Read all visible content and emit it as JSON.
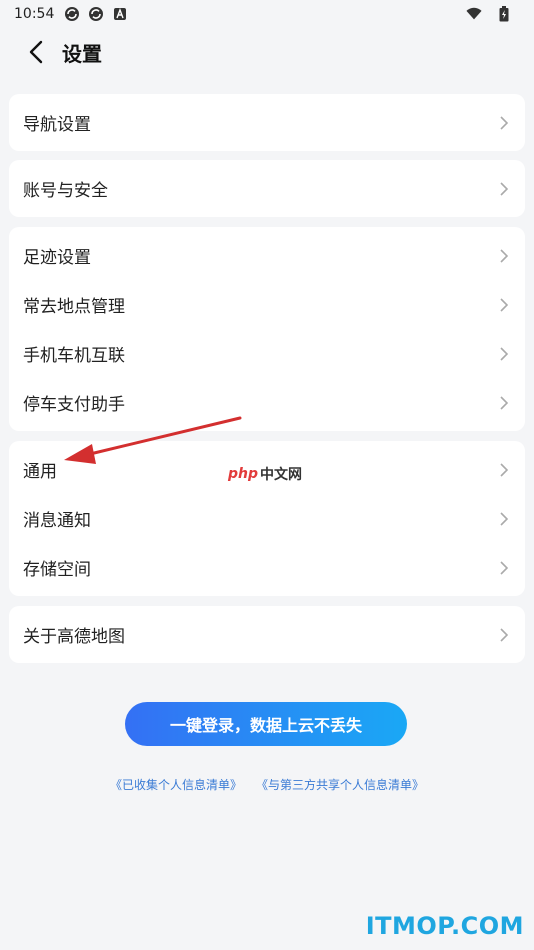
{
  "status_bar": {
    "time": "10:54"
  },
  "header": {
    "title": "设置"
  },
  "groups": [
    {
      "items": [
        {
          "label": "导航设置"
        }
      ]
    },
    {
      "items": [
        {
          "label": "账号与安全"
        }
      ]
    },
    {
      "items": [
        {
          "label": "足迹设置"
        },
        {
          "label": "常去地点管理"
        },
        {
          "label": "手机车机互联"
        },
        {
          "label": "停车支付助手"
        }
      ]
    },
    {
      "items": [
        {
          "label": "通用"
        },
        {
          "label": "消息通知"
        },
        {
          "label": "存储空间"
        }
      ]
    },
    {
      "items": [
        {
          "label": "关于高德地图"
        }
      ]
    }
  ],
  "login_button": {
    "label": "一键登录，数据上云不丢失"
  },
  "links": {
    "collected": "《已收集个人信息清单》",
    "shared": "《与第三方共享个人信息清单》"
  },
  "watermarks": {
    "php_logo": "php",
    "php_text": "中文网",
    "itmop": "ITMOP.COM"
  },
  "colors": {
    "arrow": "#d32f2f",
    "accent": "#3470f4"
  }
}
